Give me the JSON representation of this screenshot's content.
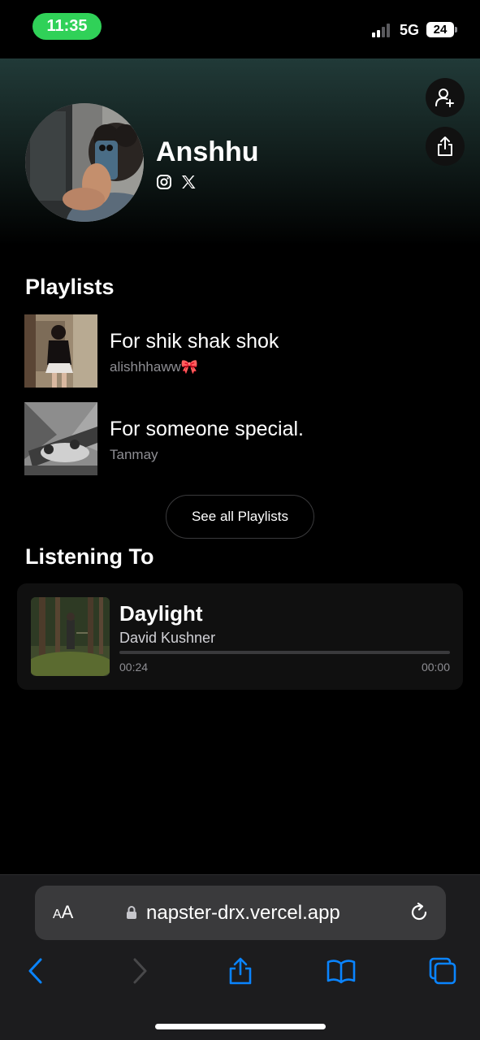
{
  "status": {
    "time": "11:35",
    "network": "5G",
    "battery": "24"
  },
  "profile": {
    "name": "Anshhu",
    "avatar": "avatar-photo"
  },
  "actions": {
    "follow_icon": "add-user-icon",
    "share_icon": "share-icon"
  },
  "playlists": {
    "title": "Playlists",
    "items": [
      {
        "name": "For shik shak shok",
        "owner": "alishhhaww🎀"
      },
      {
        "name": "For someone special.",
        "owner": "Tanmay"
      }
    ],
    "see_all_label": "See all Playlists"
  },
  "listening": {
    "title": "Listening To",
    "track": "Daylight",
    "artist": "David Kushner",
    "elapsed": "00:24",
    "duration": "00:00",
    "progress": 0
  },
  "browser": {
    "text_size_label_small": "A",
    "text_size_label_large": "A",
    "url": "napster-drx.vercel.app"
  },
  "colors": {
    "accent_green": "#30d158",
    "safari_blue": "#0a84ff",
    "background": "#000000"
  }
}
